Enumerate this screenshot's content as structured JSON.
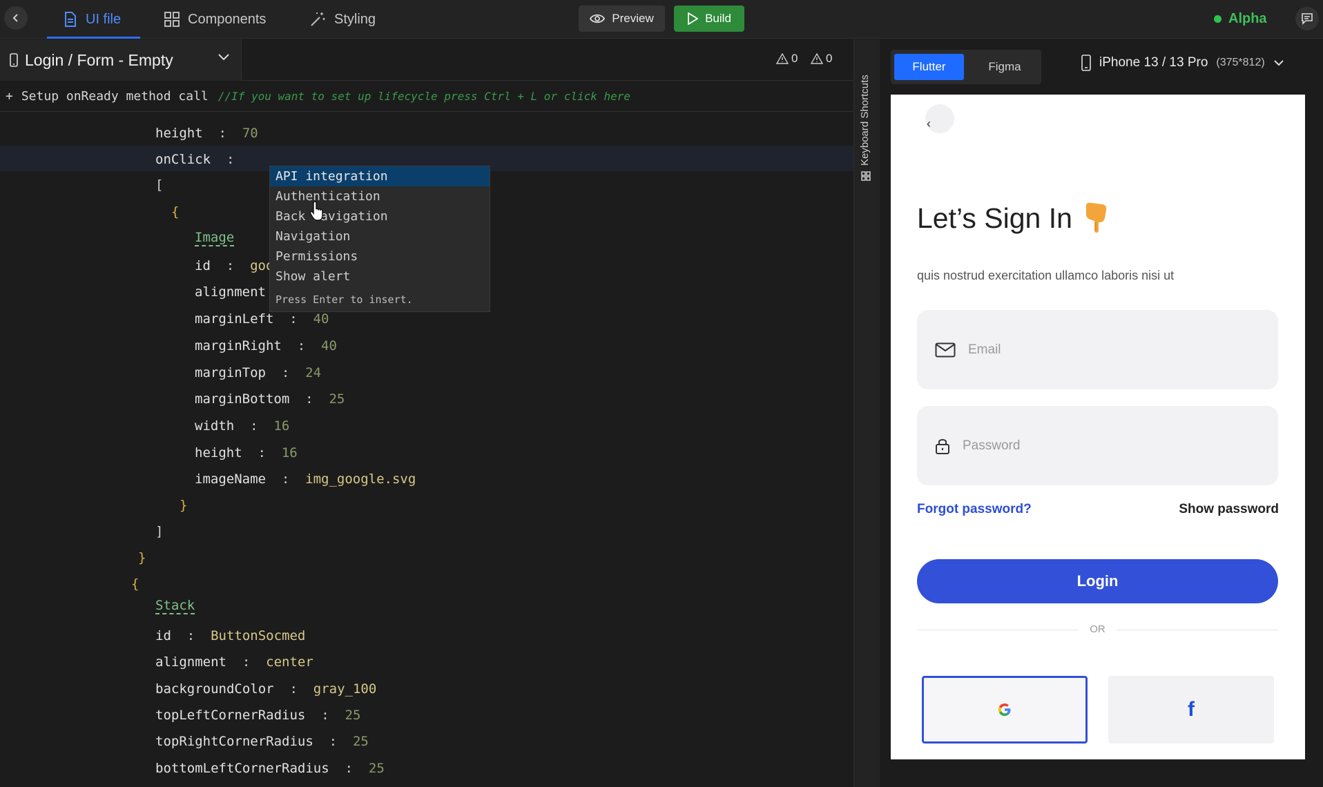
{
  "toolbar": {
    "tabs": [
      {
        "label": "UI file",
        "icon": "file-icon",
        "active": true
      },
      {
        "label": "Components",
        "icon": "grid-icon",
        "active": false
      },
      {
        "label": "Styling",
        "icon": "magic-wand-icon",
        "active": false
      }
    ],
    "preview_label": "Preview",
    "build_label": "Build",
    "env_label": "Alpha",
    "env_color": "#3fbf5a",
    "accent_color": "#2f6fff"
  },
  "filebar": {
    "file_title": "Login / Form - Empty",
    "warnings_count": "0",
    "errors_count": "0"
  },
  "setup": {
    "plus": "+",
    "command": "Setup onReady method call",
    "comment": "//If you want to set up lifecycle press Ctrl + L or click here"
  },
  "code": {
    "lines": [
      {
        "key": "height",
        "value": "70",
        "kind": "number"
      },
      {
        "key": "onClick",
        "value": "",
        "kind": "none"
      },
      {
        "text": "["
      },
      {
        "text": "{"
      },
      {
        "type": "Image"
      },
      {
        "key": "id",
        "value": "goo",
        "kind": "string"
      },
      {
        "key": "alignment",
        "value": "",
        "kind": "none"
      },
      {
        "key": "marginLeft",
        "value": "40",
        "kind": "number"
      },
      {
        "key": "marginRight",
        "value": "40",
        "kind": "number"
      },
      {
        "key": "marginTop",
        "value": "24",
        "kind": "number"
      },
      {
        "key": "marginBottom",
        "value": "25",
        "kind": "number"
      },
      {
        "key": "width",
        "value": "16",
        "kind": "number"
      },
      {
        "key": "height",
        "value": "16",
        "kind": "number"
      },
      {
        "key": "imageName",
        "value": "img_google.svg",
        "kind": "string"
      },
      {
        "text": "}"
      },
      {
        "text": "]"
      },
      {
        "text": "}"
      },
      {
        "text": "{"
      },
      {
        "type": "Stack"
      },
      {
        "key": "id",
        "value": "ButtonSocmed",
        "kind": "string"
      },
      {
        "key": "alignment",
        "value": "center",
        "kind": "string"
      },
      {
        "key": "backgroundColor",
        "value": "gray_100",
        "kind": "string"
      },
      {
        "key": "topLeftCornerRadius",
        "value": "25",
        "kind": "number"
      },
      {
        "key": "topRightCornerRadius",
        "value": "25",
        "kind": "number"
      },
      {
        "key": "bottomLeftCornerRadius",
        "value": "25",
        "kind": "number"
      }
    ]
  },
  "autocomplete": {
    "items": [
      {
        "label": "API integration",
        "selected": true
      },
      {
        "label": "Authentication",
        "selected": false
      },
      {
        "label": "Back navigation",
        "selected": false
      },
      {
        "label": "Navigation",
        "selected": false
      },
      {
        "label": "Permissions",
        "selected": false
      },
      {
        "label": "Show alert",
        "selected": false
      }
    ],
    "hint": "Press Enter to insert."
  },
  "shortcuts": {
    "label": "Keyboard Shortcuts"
  },
  "preview_panel": {
    "framework_tabs": [
      {
        "label": "Flutter",
        "active": true
      },
      {
        "label": "Figma",
        "active": false
      }
    ],
    "device_name": "iPhone 13 / 13 Pro",
    "device_dims": "(375*812)"
  },
  "phone": {
    "back_glyph": "‹",
    "title": "Let’s Sign In",
    "title_emoji": "hand-pointing-down",
    "subtitle": "quis nostrud exercitation ullamco laboris nisi ut",
    "email_placeholder": "Email",
    "password_placeholder": "Password",
    "forgot_label": "Forgot password?",
    "show_password_label": "Show password",
    "login_label": "Login",
    "or_label": "OR",
    "primary_color": "#3250d8",
    "facebook_glyph": "f"
  }
}
